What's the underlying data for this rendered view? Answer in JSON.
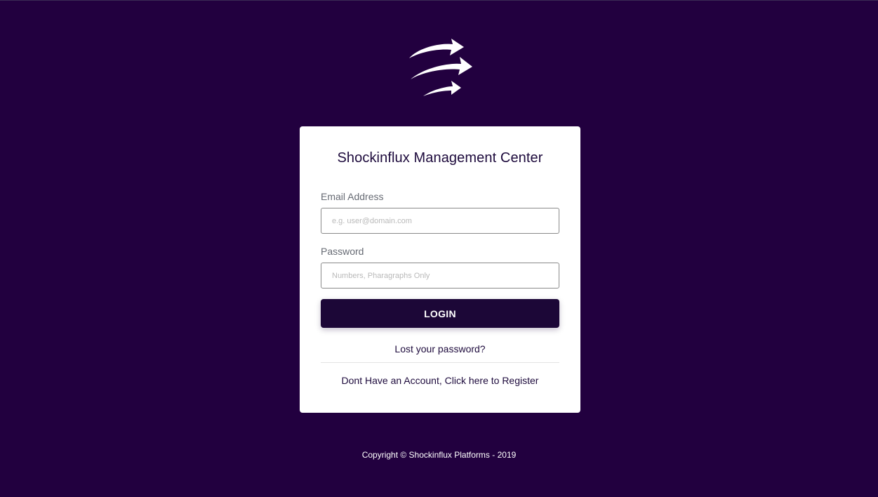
{
  "logo": {
    "icon": "swirl-arrows-logo-icon",
    "color": "#ffffff"
  },
  "card": {
    "title": "Shockinflux Management Center",
    "email": {
      "label": "Email Address",
      "value": "",
      "placeholder": "e.g. user@domain.com"
    },
    "password": {
      "label": "Password",
      "value": "",
      "placeholder": "Numbers, Pharagraphs Only"
    },
    "login_label": "LOGIN",
    "lost_password_label": "Lost your password?",
    "register_label": "Dont Have an Account, Click here to Register"
  },
  "footer": {
    "copyright": "Copyright © Shockinflux Platforms - 2019"
  },
  "colors": {
    "background": "#22003f",
    "card": "#ffffff",
    "button": "#1c0737",
    "text_dark": "#1d0a3c",
    "label": "#666a73"
  }
}
